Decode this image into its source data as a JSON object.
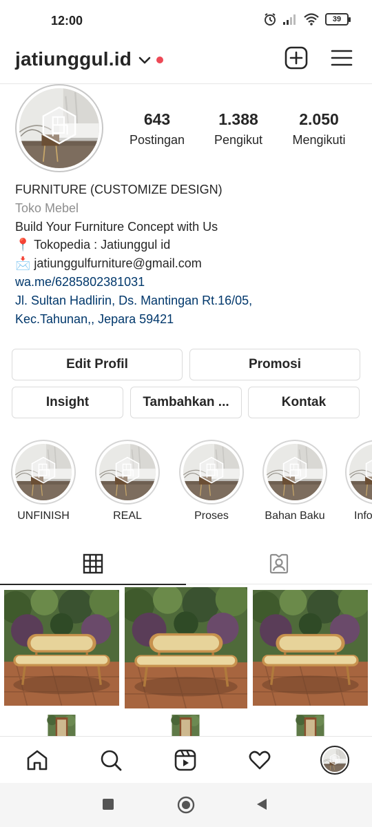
{
  "status_bar": {
    "time": "12:00",
    "battery": "39"
  },
  "header": {
    "username": "jatiunggul.id"
  },
  "stats": [
    {
      "value": "643",
      "label": "Postingan"
    },
    {
      "value": "1.388",
      "label": "Pengikut"
    },
    {
      "value": "2.050",
      "label": "Mengikuti"
    }
  ],
  "bio": {
    "name": "FURNITURE (CUSTOMIZE DESIGN)",
    "category": "Toko Mebel",
    "line1": "Build Your Furniture Concept with Us",
    "line2": "📍 Tokopedia : Jatiunggul id",
    "line3": "📩 jatiunggulfurniture@gmail.com",
    "link": "wa.me/6285802381031",
    "address1": "Jl. Sultan Hadlirin, Ds. Mantingan Rt.16/05,",
    "address2": "Kec.Tahunan,, Jepara 59421"
  },
  "buttons": {
    "edit_profile": "Edit Profil",
    "promotion": "Promosi",
    "insight": "Insight",
    "add": "Tambahkan ...",
    "contact": "Kontak"
  },
  "highlights": [
    {
      "label": "UNFINISH"
    },
    {
      "label": "REAL"
    },
    {
      "label": "Proses"
    },
    {
      "label": "Bahan Baku"
    },
    {
      "label": "Info"
    }
  ],
  "icons": {
    "chevron": "chevron-down-icon",
    "add": "plus-square-icon",
    "menu": "hamburger-menu-icon",
    "grid": "grid-icon",
    "tagged": "tagged-person-icon",
    "home": "home-icon",
    "search": "search-icon",
    "reels": "reels-icon",
    "activity": "heart-icon",
    "profile": "profile-avatar-icon"
  },
  "colors": {
    "link": "#00376b",
    "dot": "#ed4956",
    "muted": "#8e8e8e"
  }
}
